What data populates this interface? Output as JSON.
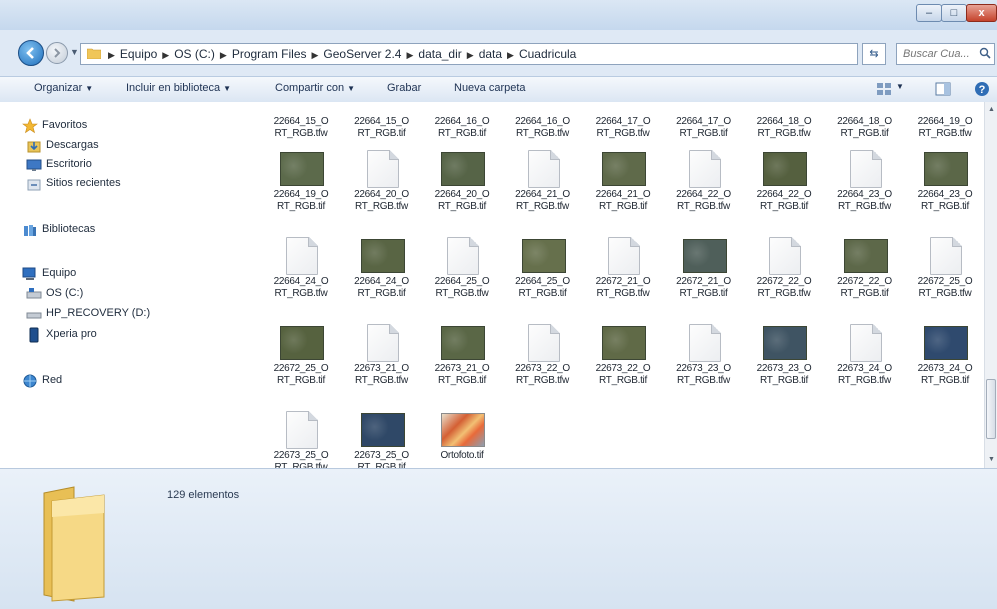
{
  "window": {
    "controls": {
      "minimize": "–",
      "maximize": "□",
      "close": "x"
    }
  },
  "address": {
    "path": [
      "Equipo",
      "OS (C:)",
      "Program Files",
      "GeoServer 2.4",
      "data_dir",
      "data",
      "Cuadricula"
    ],
    "search_placeholder": "Buscar Cua..."
  },
  "toolbar": {
    "organize": "Organizar",
    "include": "Incluir en biblioteca",
    "share": "Compartir con",
    "burn": "Grabar",
    "new_folder": "Nueva carpeta"
  },
  "sidebar": {
    "favorites": "Favoritos",
    "downloads": "Descargas",
    "desktop": "Escritorio",
    "recent": "Sitios recientes",
    "libraries": "Bibliotecas",
    "computer": "Equipo",
    "drive_c": "OS (C:)",
    "drive_d": "HP_RECOVERY (D:)",
    "xperia": "Xperia pro",
    "network": "Red"
  },
  "files": [
    {
      "name": "22664_15_O\nRT_RGB.tfw",
      "kind": "doc"
    },
    {
      "name": "22664_15_O\nRT_RGB.tif",
      "kind": "photo"
    },
    {
      "name": "22664_16_O\nRT_RGB.tif",
      "kind": "photo"
    },
    {
      "name": "22664_16_O\nRT_RGB.tfw",
      "kind": "doc"
    },
    {
      "name": "22664_17_O\nRT_RGB.tfw",
      "kind": "doc"
    },
    {
      "name": "22664_17_O\nRT_RGB.tif",
      "kind": "photo"
    },
    {
      "name": "22664_18_O\nRT_RGB.tfw",
      "kind": "doc"
    },
    {
      "name": "22664_18_O\nRT_RGB.tif",
      "kind": "photo"
    },
    {
      "name": "22664_19_O\nRT_RGB.tfw",
      "kind": "doc"
    },
    {
      "name": "22664_19_O\nRT_RGB.tif",
      "kind": "photo",
      "tone": "#5c6a4b"
    },
    {
      "name": "22664_20_O\nRT_RGB.tfw",
      "kind": "doc"
    },
    {
      "name": "22664_20_O\nRT_RGB.tif",
      "kind": "photo",
      "tone": "#566447"
    },
    {
      "name": "22664_21_O\nRT_RGB.tfw",
      "kind": "doc"
    },
    {
      "name": "22664_21_O\nRT_RGB.tif",
      "kind": "photo",
      "tone": "#5f6a4a"
    },
    {
      "name": "22664_22_O\nRT_RGB.tfw",
      "kind": "doc"
    },
    {
      "name": "22664_22_O\nRT_RGB.tif",
      "kind": "photo",
      "tone": "#55603f"
    },
    {
      "name": "22664_23_O\nRT_RGB.tfw",
      "kind": "doc"
    },
    {
      "name": "22664_23_O\nRT_RGB.tif",
      "kind": "photo",
      "tone": "#5b6748"
    },
    {
      "name": "22664_24_O\nRT_RGB.tfw",
      "kind": "doc"
    },
    {
      "name": "22664_24_O\nRT_RGB.tif",
      "kind": "photo",
      "tone": "#596544"
    },
    {
      "name": "22664_25_O\nRT_RGB.tfw",
      "kind": "doc"
    },
    {
      "name": "22664_25_O\nRT_RGB.tif",
      "kind": "photo",
      "tone": "#66704c"
    },
    {
      "name": "22672_21_O\nRT_RGB.tfw",
      "kind": "doc"
    },
    {
      "name": "22672_21_O\nRT_RGB.tif",
      "kind": "photo",
      "tone": "#4f5f5a"
    },
    {
      "name": "22672_22_O\nRT_RGB.tfw",
      "kind": "doc"
    },
    {
      "name": "22672_22_O\nRT_RGB.tif",
      "kind": "photo",
      "tone": "#5d6849"
    },
    {
      "name": "22672_25_O\nRT_RGB.tfw",
      "kind": "doc"
    },
    {
      "name": "22672_25_O\nRT_RGB.tif",
      "kind": "photo",
      "tone": "#56623f"
    },
    {
      "name": "22673_21_O\nRT_RGB.tfw",
      "kind": "doc"
    },
    {
      "name": "22673_21_O\nRT_RGB.tif",
      "kind": "photo",
      "tone": "#5a6746"
    },
    {
      "name": "22673_22_O\nRT_RGB.tfw",
      "kind": "doc"
    },
    {
      "name": "22673_22_O\nRT_RGB.tif",
      "kind": "photo",
      "tone": "#606a47"
    },
    {
      "name": "22673_23_O\nRT_RGB.tfw",
      "kind": "doc"
    },
    {
      "name": "22673_23_O\nRT_RGB.tif",
      "kind": "photo",
      "tone": "#3f5463"
    },
    {
      "name": "22673_24_O\nRT_RGB.tfw",
      "kind": "doc"
    },
    {
      "name": "22673_24_O\nRT_RGB.tif",
      "kind": "photo",
      "tone": "#2f4a6e"
    },
    {
      "name": "22673_25_O\nRT_RGB.tfw",
      "kind": "doc"
    },
    {
      "name": "22673_25_O\nRT_RGB.tif",
      "kind": "photo",
      "tone": "#2f4867"
    },
    {
      "name": "Ortofoto.tif",
      "kind": "orto"
    }
  ],
  "status": {
    "item_count": "129 elementos"
  },
  "colors": {
    "accent": "#1f6fbc",
    "folder": "#f3d27a",
    "close": "#c5432c"
  }
}
